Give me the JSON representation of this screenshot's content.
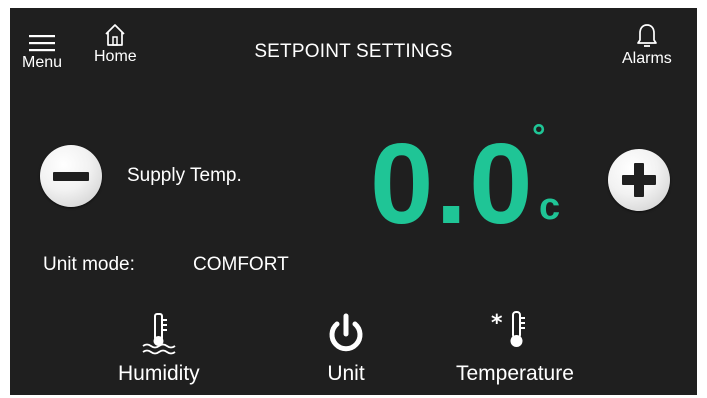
{
  "header": {
    "menu_label": "Menu",
    "home_label": "Home",
    "title": "SETPOINT SETTINGS",
    "alarms_label": "Alarms"
  },
  "setpoint": {
    "label": "Supply Temp.",
    "value": "0.0",
    "degree_symbol": "°",
    "unit": "c"
  },
  "mode": {
    "label": "Unit mode:",
    "value": "COMFORT"
  },
  "bottom_nav": {
    "humidity_label": "Humidity",
    "unit_label": "Unit",
    "temperature_label": "Temperature"
  },
  "colors": {
    "background": "#1f1f1f",
    "accent": "#1fc596",
    "text": "#ffffff"
  },
  "icons": [
    "menu-icon",
    "home-icon",
    "bell-icon",
    "minus-icon",
    "plus-icon",
    "humidity-icon",
    "power-icon",
    "thermometer-snowflake-icon"
  ]
}
